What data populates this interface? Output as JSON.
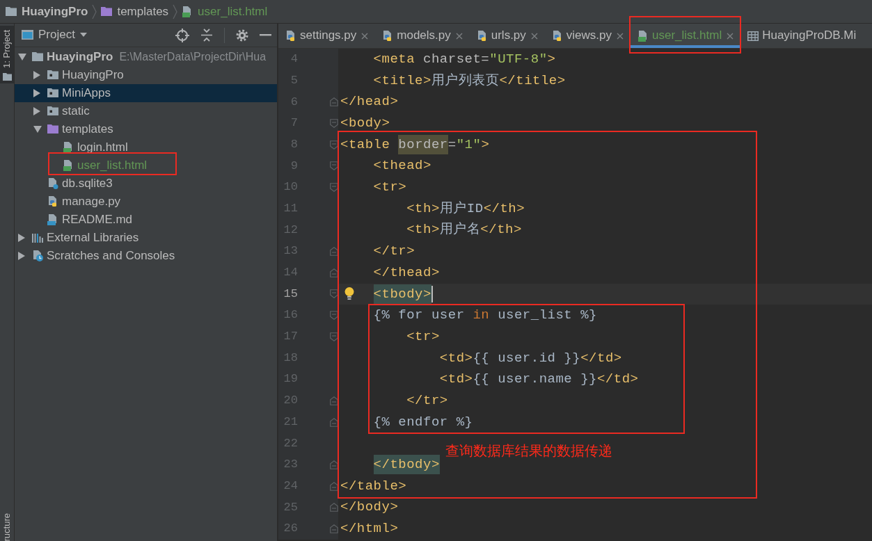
{
  "breadcrumbs": [
    {
      "label": "HuayingPro",
      "kind": "project",
      "added": false
    },
    {
      "label": "templates",
      "kind": "template_folder",
      "added": false
    },
    {
      "label": "user_list.html",
      "kind": "html",
      "added": true
    }
  ],
  "tool_window_bar": [
    {
      "label": "1: Project",
      "kind": "folder",
      "selected": true
    },
    {
      "label": "ructure",
      "kind": "text_only",
      "selected": false
    }
  ],
  "project_panel": {
    "title": "Project",
    "tree": [
      {
        "label": "HuayingPro",
        "kind": "project",
        "path": "E:\\MasterData\\ProjectDir\\Hua",
        "expanded": true,
        "selected": false,
        "added": false,
        "framed": false,
        "children": [
          {
            "label": "HuayingPro",
            "kind": "package",
            "expanded": false,
            "selected": false,
            "added": false,
            "framed": false
          },
          {
            "label": "MiniApps",
            "kind": "package",
            "expanded": false,
            "selected": true,
            "added": false,
            "framed": false
          },
          {
            "label": "static",
            "kind": "package",
            "expanded": false,
            "selected": false,
            "added": false,
            "framed": false
          },
          {
            "label": "templates",
            "kind": "template_folder",
            "expanded": true,
            "selected": false,
            "added": false,
            "framed": false,
            "children": [
              {
                "label": "login.html",
                "kind": "html",
                "selected": false,
                "added": false,
                "framed": false
              },
              {
                "label": "user_list.html",
                "kind": "html",
                "selected": false,
                "added": true,
                "framed": true
              }
            ]
          },
          {
            "label": "db.sqlite3",
            "kind": "database",
            "selected": false,
            "added": false,
            "framed": false
          },
          {
            "label": "manage.py",
            "kind": "python",
            "selected": false,
            "added": false,
            "framed": false
          },
          {
            "label": "README.md",
            "kind": "markdown",
            "selected": false,
            "added": false,
            "framed": false
          }
        ]
      },
      {
        "label": "External Libraries",
        "kind": "libraries",
        "expanded": false,
        "selected": false,
        "added": false,
        "framed": false
      },
      {
        "label": "Scratches and Consoles",
        "kind": "scratches",
        "expanded": false,
        "selected": false,
        "added": false,
        "framed": false
      }
    ]
  },
  "tabs": [
    {
      "label": "settings.py",
      "kind": "python",
      "selected": false,
      "added": false,
      "framed": false,
      "closable": true
    },
    {
      "label": "models.py",
      "kind": "python",
      "selected": false,
      "added": false,
      "framed": false,
      "closable": true
    },
    {
      "label": "urls.py",
      "kind": "python",
      "selected": false,
      "added": false,
      "framed": false,
      "closable": true
    },
    {
      "label": "views.py",
      "kind": "python",
      "selected": false,
      "added": false,
      "framed": false,
      "closable": true
    },
    {
      "label": "user_list.html",
      "kind": "html",
      "selected": true,
      "added": true,
      "framed": true,
      "closable": true
    },
    {
      "label": "HuayingProDB.Mi",
      "kind": "table",
      "selected": false,
      "added": false,
      "framed": false,
      "closable": false
    }
  ],
  "editor": {
    "lines": [
      {
        "kind": "line",
        "number": "4",
        "fold_start": false,
        "fold_end": false,
        "current": false,
        "bulb": false,
        "tokens": [
          {
            "kind": "tag",
            "text": "    <meta"
          },
          {
            "kind": "attr",
            "text": " charset="
          },
          {
            "kind": "value",
            "text": "\"UTF-8\""
          },
          {
            "kind": "tag",
            "text": ">"
          }
        ]
      },
      {
        "kind": "line",
        "number": "5",
        "fold_start": false,
        "fold_end": false,
        "current": false,
        "bulb": false,
        "tokens": [
          {
            "kind": "tag",
            "text": "    <title>"
          },
          {
            "kind": "text",
            "text": "用户列表页"
          },
          {
            "kind": "tag",
            "text": "</title>"
          }
        ]
      },
      {
        "kind": "line",
        "number": "6",
        "fold_start": false,
        "fold_end": true,
        "current": false,
        "bulb": false,
        "tokens": [
          {
            "kind": "tag",
            "text": "</head>"
          }
        ]
      },
      {
        "kind": "line",
        "number": "7",
        "fold_start": true,
        "fold_end": false,
        "current": false,
        "bulb": false,
        "tokens": [
          {
            "kind": "tag",
            "text": "<body>"
          }
        ]
      },
      {
        "kind": "frame",
        "lines": [
          {
            "kind": "line",
            "number": "8",
            "fold_start": true,
            "fold_end": false,
            "current": false,
            "bulb": false,
            "tokens": [
              {
                "kind": "tag",
                "text": "<table "
              },
              {
                "kind": "attr_mark",
                "text": "border"
              },
              {
                "kind": "attr",
                "text": "="
              },
              {
                "kind": "value",
                "text": "\"1\""
              },
              {
                "kind": "tag",
                "text": ">"
              }
            ]
          },
          {
            "kind": "line",
            "number": "9",
            "fold_start": true,
            "fold_end": false,
            "current": false,
            "bulb": false,
            "tokens": [
              {
                "kind": "tag",
                "text": "    <thead>"
              }
            ]
          },
          {
            "kind": "line",
            "number": "10",
            "fold_start": true,
            "fold_end": false,
            "current": false,
            "bulb": false,
            "tokens": [
              {
                "kind": "tag",
                "text": "    <tr>"
              }
            ]
          },
          {
            "kind": "line",
            "number": "11",
            "fold_start": false,
            "fold_end": false,
            "current": false,
            "bulb": false,
            "tokens": [
              {
                "kind": "tag",
                "text": "        <th>"
              },
              {
                "kind": "text",
                "text": "用户ID"
              },
              {
                "kind": "tag",
                "text": "</th>"
              }
            ]
          },
          {
            "kind": "line",
            "number": "12",
            "fold_start": false,
            "fold_end": false,
            "current": false,
            "bulb": false,
            "tokens": [
              {
                "kind": "tag",
                "text": "        <th>"
              },
              {
                "kind": "text",
                "text": "用户名"
              },
              {
                "kind": "tag",
                "text": "</th>"
              }
            ]
          },
          {
            "kind": "line",
            "number": "13",
            "fold_start": false,
            "fold_end": true,
            "current": false,
            "bulb": false,
            "tokens": [
              {
                "kind": "tag",
                "text": "    </tr>"
              }
            ]
          },
          {
            "kind": "line",
            "number": "14",
            "fold_start": false,
            "fold_end": true,
            "current": false,
            "bulb": false,
            "tokens": [
              {
                "kind": "tag",
                "text": "    </thead>"
              }
            ]
          },
          {
            "kind": "line",
            "number": "15",
            "fold_start": true,
            "fold_end": false,
            "current": true,
            "bulb": true,
            "tokens": [
              {
                "kind": "tag_match",
                "text": "    <tbody>"
              }
            ]
          },
          {
            "kind": "frame",
            "note": "查询数据库结果的数据传递",
            "lines": [
              {
                "kind": "line",
                "number": "16",
                "fold_start": true,
                "fold_end": false,
                "current": false,
                "bulb": false,
                "tokens": [
                  {
                    "kind": "plain",
                    "text": "    {% for user "
                  },
                  {
                    "kind": "keyword",
                    "text": "in"
                  },
                  {
                    "kind": "plain",
                    "text": " user_list %}"
                  }
                ]
              },
              {
                "kind": "line",
                "number": "17",
                "fold_start": true,
                "fold_end": false,
                "current": false,
                "bulb": false,
                "tokens": [
                  {
                    "kind": "tag",
                    "text": "        <tr>"
                  }
                ]
              },
              {
                "kind": "line",
                "number": "18",
                "fold_start": false,
                "fold_end": false,
                "current": false,
                "bulb": false,
                "tokens": [
                  {
                    "kind": "tag",
                    "text": "            <td>"
                  },
                  {
                    "kind": "plain",
                    "text": "{{ user.id }}"
                  },
                  {
                    "kind": "tag",
                    "text": "</td>"
                  }
                ]
              },
              {
                "kind": "line",
                "number": "19",
                "fold_start": false,
                "fold_end": false,
                "current": false,
                "bulb": false,
                "tokens": [
                  {
                    "kind": "tag",
                    "text": "            <td>"
                  },
                  {
                    "kind": "plain",
                    "text": "{{ user.name }}"
                  },
                  {
                    "kind": "tag",
                    "text": "</td>"
                  }
                ]
              },
              {
                "kind": "line",
                "number": "20",
                "fold_start": false,
                "fold_end": true,
                "current": false,
                "bulb": false,
                "tokens": [
                  {
                    "kind": "tag",
                    "text": "        </tr>"
                  }
                ]
              },
              {
                "kind": "line",
                "number": "21",
                "fold_start": false,
                "fold_end": true,
                "current": false,
                "bulb": false,
                "tokens": [
                  {
                    "kind": "plain",
                    "text": "    {% endfor %}"
                  }
                ]
              }
            ]
          },
          {
            "kind": "line",
            "number": "22",
            "fold_start": false,
            "fold_end": false,
            "current": false,
            "bulb": false
          },
          {
            "kind": "line",
            "number": "23",
            "fold_start": false,
            "fold_end": true,
            "current": false,
            "bulb": false,
            "tokens": [
              {
                "kind": "tag_match",
                "text": "    </tbody>"
              }
            ]
          },
          {
            "kind": "line",
            "number": "24",
            "fold_start": false,
            "fold_end": true,
            "current": false,
            "bulb": false,
            "tokens": [
              {
                "kind": "tag",
                "text": "</table>"
              }
            ]
          }
        ]
      },
      {
        "kind": "line",
        "number": "25",
        "fold_start": false,
        "fold_end": true,
        "current": false,
        "bulb": false,
        "tokens": [
          {
            "kind": "tag",
            "text": "</body>"
          }
        ]
      },
      {
        "kind": "line",
        "number": "26",
        "fold_start": false,
        "fold_end": true,
        "current": false,
        "bulb": false,
        "tokens": [
          {
            "kind": "tag",
            "text": "</html>"
          }
        ]
      }
    ]
  }
}
